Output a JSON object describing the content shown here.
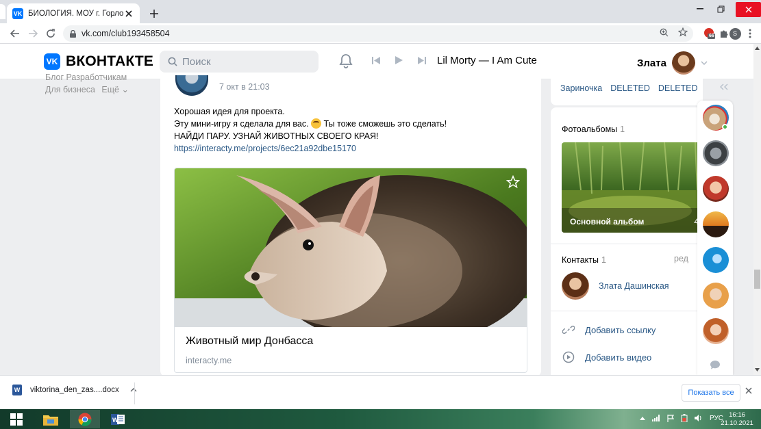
{
  "browser": {
    "tab_title": "БИОЛОГИЯ. МОУ г. Горловки \"Ш",
    "tab_favicon": "VK",
    "url": "vk.com/club193458504",
    "profile_letter": "S",
    "ext_badge": "66"
  },
  "vk": {
    "logo_mark": "VK",
    "logo_text": "ВКОНТАКТЕ",
    "search_placeholder": "Поиск",
    "now_playing": "Lil Morty — I Am Cute",
    "user_name": "Злата"
  },
  "left_menu": {
    "line1": "Блог   Разработчикам",
    "business": "Для бизнеса",
    "more": "Ещё ⌄"
  },
  "post": {
    "date": "7 окт в 21:03",
    "line1": "Хорошая идея для проекта.",
    "line2a": "Эту мини-игру я сделала для вас.",
    "line2b": "Ты тоже сможешь это сделать!",
    "line3": "НАЙДИ ПАРУ. УЗНАЙ ЖИВОТНЫХ СВОЕГО КРАЯ!",
    "link": "https://interacty.me/projects/6ec21a92dbe15170",
    "snippet_title": "Животный мир Донбасса",
    "snippet_domain": "interacty.me"
  },
  "right": {
    "members": [
      "Зариночка",
      "DELETED",
      "DELETED"
    ],
    "albums_title": "Фотоальбомы",
    "albums_count": "1",
    "album_name": "Основной альбом",
    "album_photos": "4",
    "contacts_title": "Контакты",
    "contacts_count": "1",
    "contacts_edit": "ред",
    "contact_name": "Злата Дашинская",
    "add_link": "Добавить ссылку",
    "add_video": "Добавить видео"
  },
  "downloads": {
    "file": "viktorina_den_zas....docx",
    "show_all": "Показать все"
  },
  "taskbar": {
    "lang": "РУС",
    "time": "16:16",
    "date": "21.10.2021"
  },
  "colors": {
    "vk_blue": "#0077ff",
    "link": "#2a5885",
    "online": "#4bb34b"
  }
}
